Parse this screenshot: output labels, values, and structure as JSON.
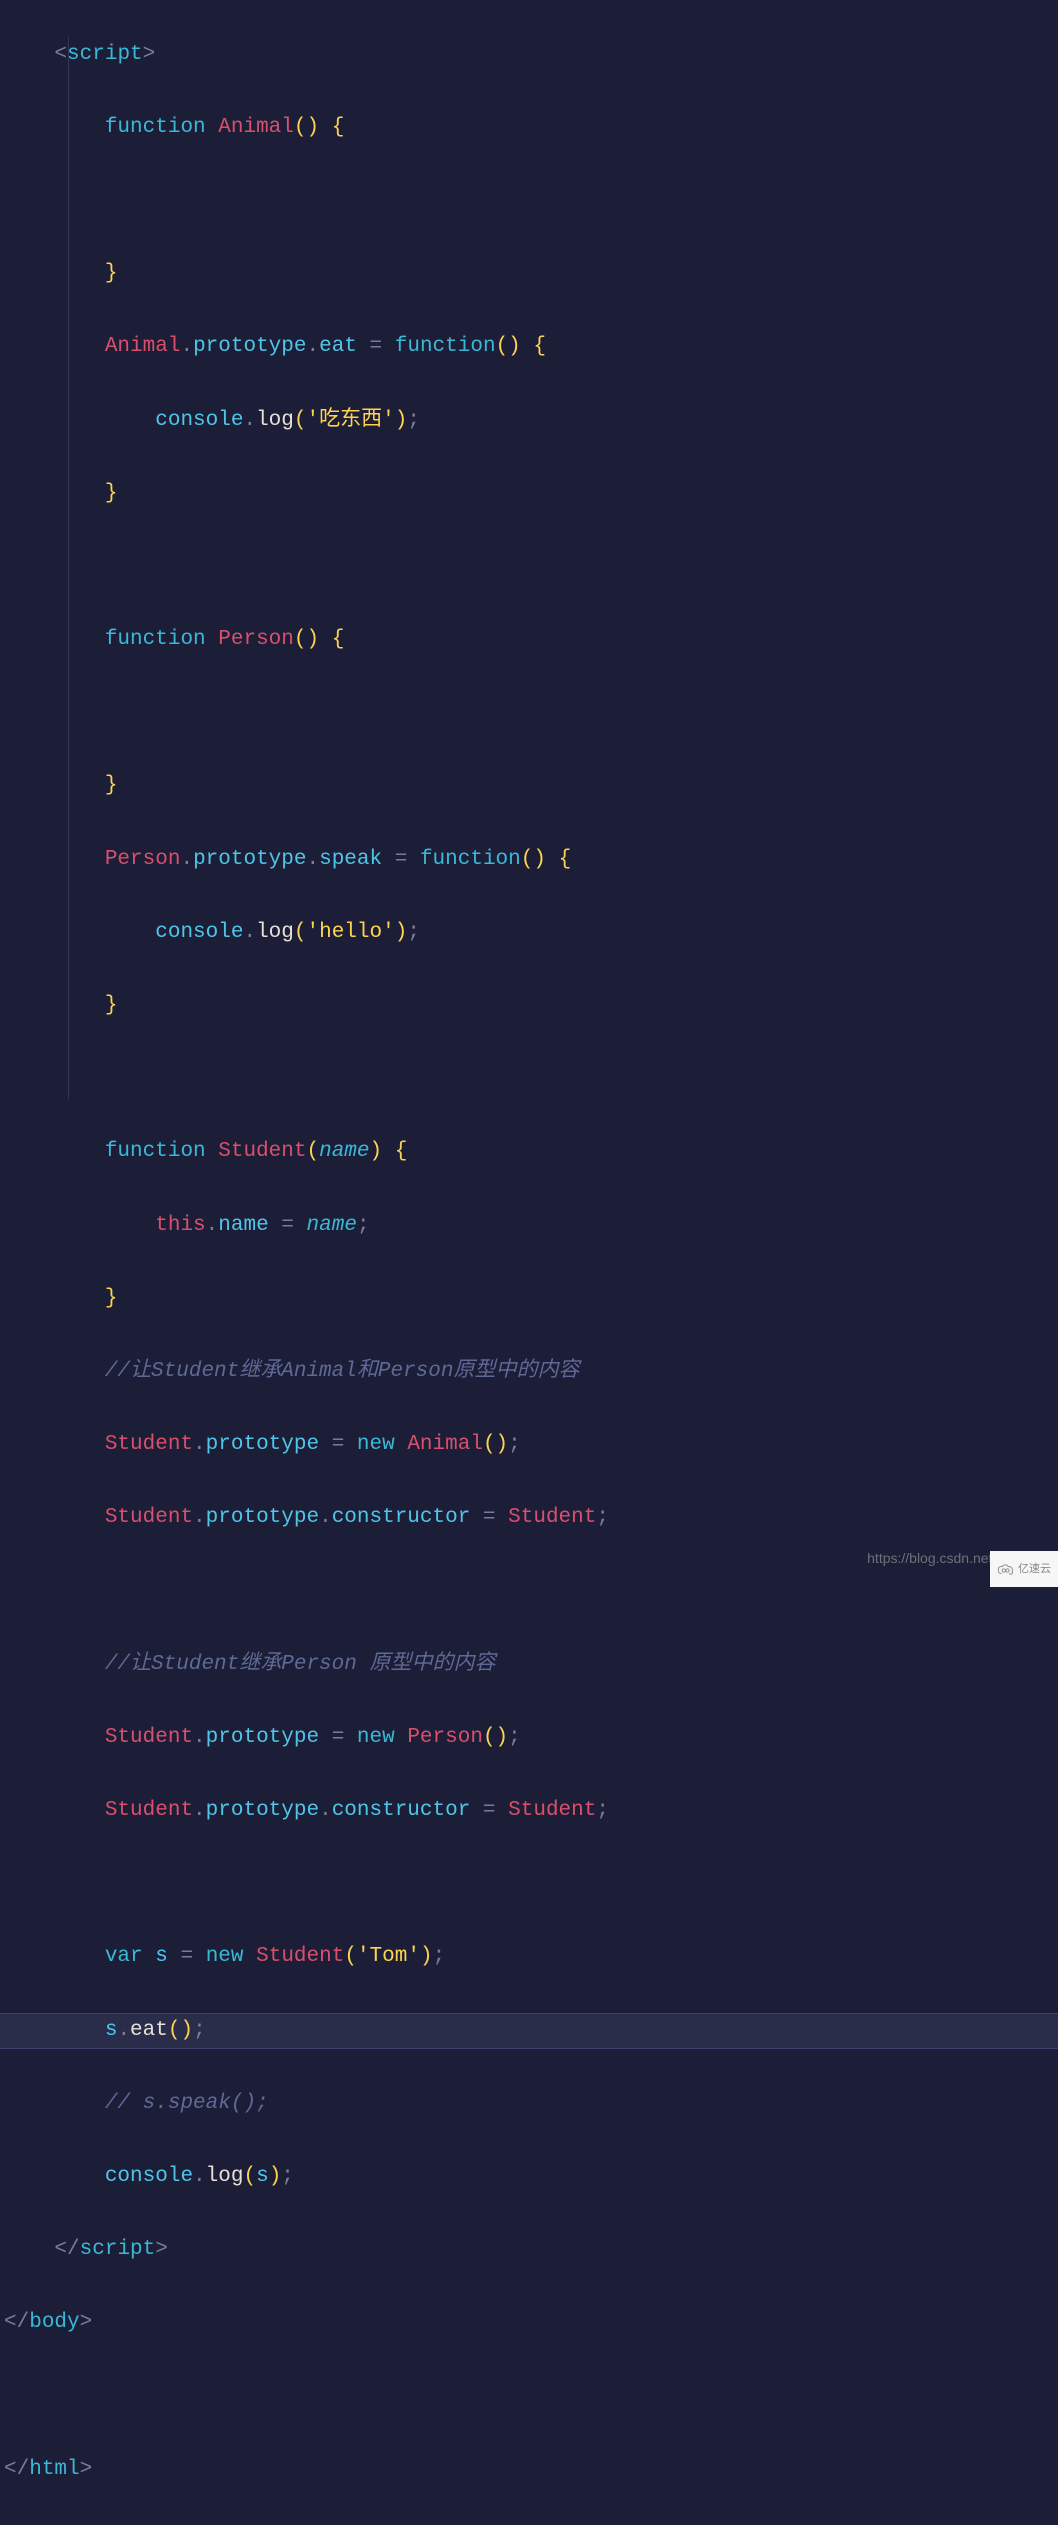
{
  "tokens": {
    "script_open": "script",
    "script_close": "script",
    "body_close": "body",
    "html_close": "html",
    "function": "function",
    "Animal": "Animal",
    "Person": "Person",
    "Student": "Student",
    "prototype": "prototype",
    "eat": "eat",
    "speak": "speak",
    "constructor": "constructor",
    "console": "console",
    "log": "log",
    "this": "this",
    "name": "name",
    "name_param": "name",
    "new": "new",
    "var": "var",
    "s": "s",
    "Tom": "'Tom'",
    "hello": "'hello'",
    "eat_str": "'吃东西'"
  },
  "comments": {
    "c1": "//让Student继承Animal和Person原型中的内容",
    "c2": "//让Student继承Person 原型中的内容",
    "c3": "// s.speak();"
  },
  "watermark": "https://blog.csdn.net/m",
  "badge": "亿速云"
}
